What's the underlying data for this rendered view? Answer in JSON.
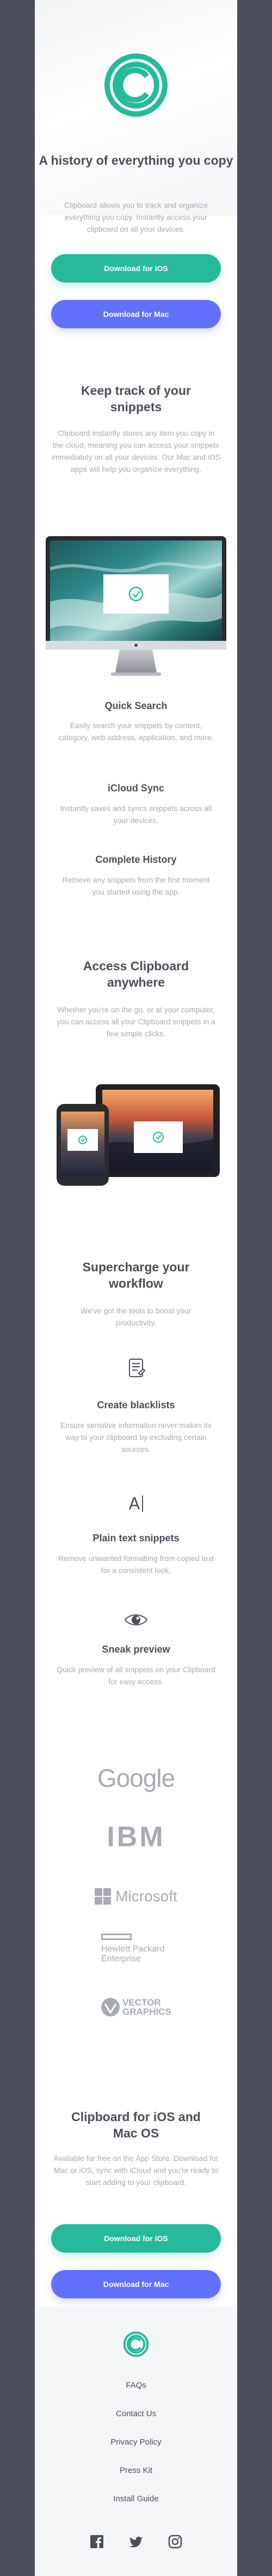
{
  "colors": {
    "accent": "#26ba9a",
    "secondary": "#6271fd",
    "heading": "#4a4f59",
    "body": "#a7abb2",
    "frame": "#4a4f59"
  },
  "hero": {
    "title": "A history of everything you copy",
    "text": "Clipboard allows you to track and organize everything you copy. Instantly access your clipboard on all your devices.",
    "ios_button": "Download for iOS",
    "mac_button": "Download for Mac"
  },
  "snippets": {
    "title": "Keep track of your snippets",
    "text": "Clipboard instantly stores any item you copy in the cloud, meaning you can access your snippets immediately on all your devices. Our Mac and iOS apps will help you organize everything.",
    "features": [
      {
        "title": "Quick Search",
        "text": "Easily search your snippets by content, category, web address, application, and more."
      },
      {
        "title": "iCloud Sync",
        "text": "Instantly saves and syncs snippets across all your devices."
      },
      {
        "title": "Complete History",
        "text": "Retrieve any snippets from the first moment you started using the app."
      }
    ]
  },
  "access": {
    "title": "Access Clipboard anywhere",
    "text": "Whether you're on the go, or at your computer, you can access all your Clipboard snippets in a few simple clicks."
  },
  "workflow": {
    "title": "Supercharge your workflow",
    "text": "We've got the tools to boost your productivity.",
    "items": [
      {
        "icon": "document-icon",
        "title": "Create blacklists",
        "text": "Ensure sensitive information never makes its way to your clipboard by excluding certain sources."
      },
      {
        "icon": "text-cursor-icon",
        "glyph": "A",
        "title": "Plain text snippets",
        "text": "Remove unwanted formatting from copied text for a consistent look."
      },
      {
        "icon": "eye-icon",
        "title": "Sneak preview",
        "text": "Quick preview of all snippets on your Clipboard for easy access."
      }
    ]
  },
  "brands": {
    "google": "Google",
    "ibm": "IBM",
    "microsoft": "Microsoft",
    "hp_line1": "Hewlett Packard",
    "hp_line2": "Enterprise",
    "vector_line1": "VECTOR",
    "vector_line2": "GRAPHICS"
  },
  "cta": {
    "title": "Clipboard for iOS and Mac OS",
    "text": "Available for free on the App Store. Download for Mac or iOS, sync with iCloud and you're ready to start adding to your clipboard.",
    "ios_button": "Download for iOS",
    "mac_button": "Download for Mac"
  },
  "footer": {
    "links": [
      "FAQs",
      "Contact Us",
      "Privacy Policy",
      "Press Kit",
      "Install Guide"
    ],
    "social": [
      "facebook-icon",
      "twitter-icon",
      "instagram-icon"
    ]
  }
}
